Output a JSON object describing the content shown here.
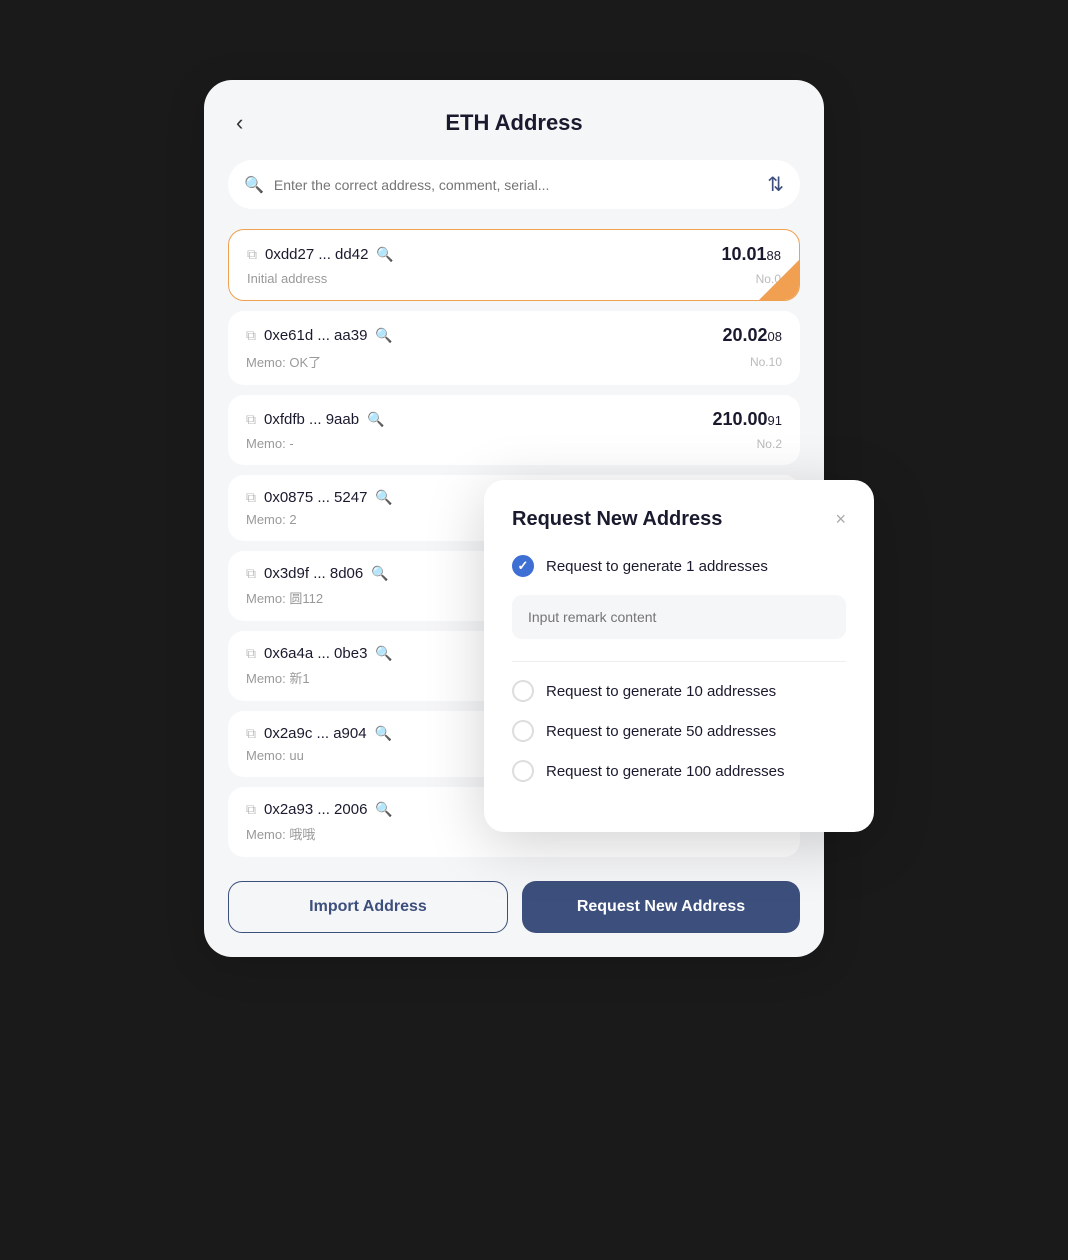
{
  "header": {
    "back_label": "‹",
    "title": "ETH Address"
  },
  "search": {
    "placeholder": "Enter the correct address, comment, serial..."
  },
  "addresses": [
    {
      "hash": "0xdd27 ... dd42",
      "amount_main": "10.01",
      "amount_decimal": "88",
      "memo": "Initial address",
      "no": "No.0",
      "active": true,
      "corner": true
    },
    {
      "hash": "0xe61d ... aa39",
      "amount_main": "20.02",
      "amount_decimal": "08",
      "memo": "Memo: OK了",
      "no": "No.10",
      "active": false,
      "corner": false
    },
    {
      "hash": "0xfdfb ... 9aab",
      "amount_main": "210.00",
      "amount_decimal": "91",
      "memo": "Memo: -",
      "no": "No.2",
      "active": false,
      "corner": false
    },
    {
      "hash": "0x0875 ... 5247",
      "amount_main": "",
      "amount_decimal": "",
      "memo": "Memo: 2",
      "no": "",
      "active": false,
      "corner": false
    },
    {
      "hash": "0x3d9f ... 8d06",
      "amount_main": "",
      "amount_decimal": "",
      "memo": "Memo: 圆112",
      "no": "",
      "active": false,
      "corner": false
    },
    {
      "hash": "0x6a4a ... 0be3",
      "amount_main": "",
      "amount_decimal": "",
      "memo": "Memo: 新1",
      "no": "",
      "active": false,
      "corner": false
    },
    {
      "hash": "0x2a9c ... a904",
      "amount_main": "",
      "amount_decimal": "",
      "memo": "Memo: uu",
      "no": "",
      "active": false,
      "corner": false
    },
    {
      "hash": "0x2a93 ... 2006",
      "amount_main": "",
      "amount_decimal": "",
      "memo": "Memo: 哦哦",
      "no": "",
      "active": false,
      "corner": false
    }
  ],
  "footer": {
    "import_label": "Import Address",
    "request_label": "Request New Address"
  },
  "modal": {
    "title": "Request New Address",
    "close_label": "×",
    "options": [
      {
        "label": "Request to generate 1 addresses",
        "checked": true
      },
      {
        "label": "Request to generate 10 addresses",
        "checked": false
      },
      {
        "label": "Request to generate 50 addresses",
        "checked": false
      },
      {
        "label": "Request to generate 100 addresses",
        "checked": false
      }
    ],
    "remark_placeholder": "Input remark content"
  }
}
